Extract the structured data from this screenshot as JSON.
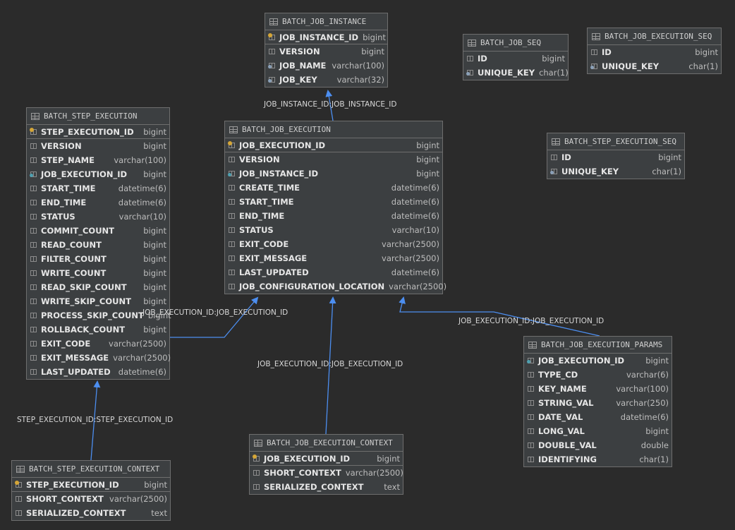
{
  "tables": [
    {
      "id": "batch_job_instance",
      "name": "BATCH_JOB_INSTANCE",
      "columns": [
        {
          "name": "JOB_INSTANCE_ID",
          "type": "bigint",
          "pk": true
        },
        {
          "name": "VERSION",
          "type": "bigint"
        },
        {
          "name": "JOB_NAME",
          "type": "varchar(100)",
          "idx": true
        },
        {
          "name": "JOB_KEY",
          "type": "varchar(32)",
          "idx": true
        }
      ]
    },
    {
      "id": "batch_job_seq",
      "name": "BATCH_JOB_SEQ",
      "columns": [
        {
          "name": "ID",
          "type": "bigint"
        },
        {
          "name": "UNIQUE_KEY",
          "type": "char(1)",
          "idx": true
        }
      ]
    },
    {
      "id": "batch_job_execution_seq",
      "name": "BATCH_JOB_EXECUTION_SEQ",
      "columns": [
        {
          "name": "ID",
          "type": "bigint"
        },
        {
          "name": "UNIQUE_KEY",
          "type": "char(1)",
          "idx": true
        }
      ]
    },
    {
      "id": "batch_step_execution",
      "name": "BATCH_STEP_EXECUTION",
      "columns": [
        {
          "name": "STEP_EXECUTION_ID",
          "type": "bigint",
          "pk": true
        },
        {
          "name": "VERSION",
          "type": "bigint"
        },
        {
          "name": "STEP_NAME",
          "type": "varchar(100)"
        },
        {
          "name": "JOB_EXECUTION_ID",
          "type": "bigint",
          "fk": true
        },
        {
          "name": "START_TIME",
          "type": "datetime(6)"
        },
        {
          "name": "END_TIME",
          "type": "datetime(6)"
        },
        {
          "name": "STATUS",
          "type": "varchar(10)"
        },
        {
          "name": "COMMIT_COUNT",
          "type": "bigint"
        },
        {
          "name": "READ_COUNT",
          "type": "bigint"
        },
        {
          "name": "FILTER_COUNT",
          "type": "bigint"
        },
        {
          "name": "WRITE_COUNT",
          "type": "bigint"
        },
        {
          "name": "READ_SKIP_COUNT",
          "type": "bigint"
        },
        {
          "name": "WRITE_SKIP_COUNT",
          "type": "bigint"
        },
        {
          "name": "PROCESS_SKIP_COUNT",
          "type": "bigint"
        },
        {
          "name": "ROLLBACK_COUNT",
          "type": "bigint"
        },
        {
          "name": "EXIT_CODE",
          "type": "varchar(2500)"
        },
        {
          "name": "EXIT_MESSAGE",
          "type": "varchar(2500)"
        },
        {
          "name": "LAST_UPDATED",
          "type": "datetime(6)"
        }
      ]
    },
    {
      "id": "batch_job_execution",
      "name": "BATCH_JOB_EXECUTION",
      "columns": [
        {
          "name": "JOB_EXECUTION_ID",
          "type": "bigint",
          "pk": true
        },
        {
          "name": "VERSION",
          "type": "bigint"
        },
        {
          "name": "JOB_INSTANCE_ID",
          "type": "bigint",
          "fk": true
        },
        {
          "name": "CREATE_TIME",
          "type": "datetime(6)"
        },
        {
          "name": "START_TIME",
          "type": "datetime(6)"
        },
        {
          "name": "END_TIME",
          "type": "datetime(6)"
        },
        {
          "name": "STATUS",
          "type": "varchar(10)"
        },
        {
          "name": "EXIT_CODE",
          "type": "varchar(2500)"
        },
        {
          "name": "EXIT_MESSAGE",
          "type": "varchar(2500)"
        },
        {
          "name": "LAST_UPDATED",
          "type": "datetime(6)"
        },
        {
          "name": "JOB_CONFIGURATION_LOCATION",
          "type": "varchar(2500)"
        }
      ]
    },
    {
      "id": "batch_step_execution_seq",
      "name": "BATCH_STEP_EXECUTION_SEQ",
      "columns": [
        {
          "name": "ID",
          "type": "bigint"
        },
        {
          "name": "UNIQUE_KEY",
          "type": "char(1)",
          "idx": true
        }
      ]
    },
    {
      "id": "batch_job_execution_params",
      "name": "BATCH_JOB_EXECUTION_PARAMS",
      "columns": [
        {
          "name": "JOB_EXECUTION_ID",
          "type": "bigint",
          "fk": true
        },
        {
          "name": "TYPE_CD",
          "type": "varchar(6)"
        },
        {
          "name": "KEY_NAME",
          "type": "varchar(100)"
        },
        {
          "name": "STRING_VAL",
          "type": "varchar(250)"
        },
        {
          "name": "DATE_VAL",
          "type": "datetime(6)"
        },
        {
          "name": "LONG_VAL",
          "type": "bigint"
        },
        {
          "name": "DOUBLE_VAL",
          "type": "double"
        },
        {
          "name": "IDENTIFYING",
          "type": "char(1)"
        }
      ]
    },
    {
      "id": "batch_job_execution_context",
      "name": "BATCH_JOB_EXECUTION_CONTEXT",
      "columns": [
        {
          "name": "JOB_EXECUTION_ID",
          "type": "bigint",
          "pk": true
        },
        {
          "name": "SHORT_CONTEXT",
          "type": "varchar(2500)"
        },
        {
          "name": "SERIALIZED_CONTEXT",
          "type": "text"
        }
      ]
    },
    {
      "id": "batch_step_execution_context",
      "name": "BATCH_STEP_EXECUTION_CONTEXT",
      "columns": [
        {
          "name": "STEP_EXECUTION_ID",
          "type": "bigint",
          "pk": true
        },
        {
          "name": "SHORT_CONTEXT",
          "type": "varchar(2500)"
        },
        {
          "name": "SERIALIZED_CONTEXT",
          "type": "text"
        }
      ]
    }
  ],
  "relations": [
    {
      "from": "batch_job_execution",
      "to": "batch_job_instance",
      "label": "JOB_INSTANCE_ID:JOB_INSTANCE_ID"
    },
    {
      "from": "batch_step_execution",
      "to": "batch_job_execution",
      "label": "JOB_EXECUTION_ID:JOB_EXECUTION_ID"
    },
    {
      "from": "batch_job_execution_context",
      "to": "batch_job_execution",
      "label": "JOB_EXECUTION_ID:JOB_EXECUTION_ID"
    },
    {
      "from": "batch_job_execution_params",
      "to": "batch_job_execution",
      "label": "JOB_EXECUTION_ID:JOB_EXECUTION_ID"
    },
    {
      "from": "batch_step_execution_context",
      "to": "batch_step_execution",
      "label": "STEP_EXECUTION_ID:STEP_EXECUTION_ID"
    }
  ],
  "colors": {
    "background": "#2b2b2b",
    "table": "#3c3f41",
    "edge": "#4c8ef0"
  }
}
